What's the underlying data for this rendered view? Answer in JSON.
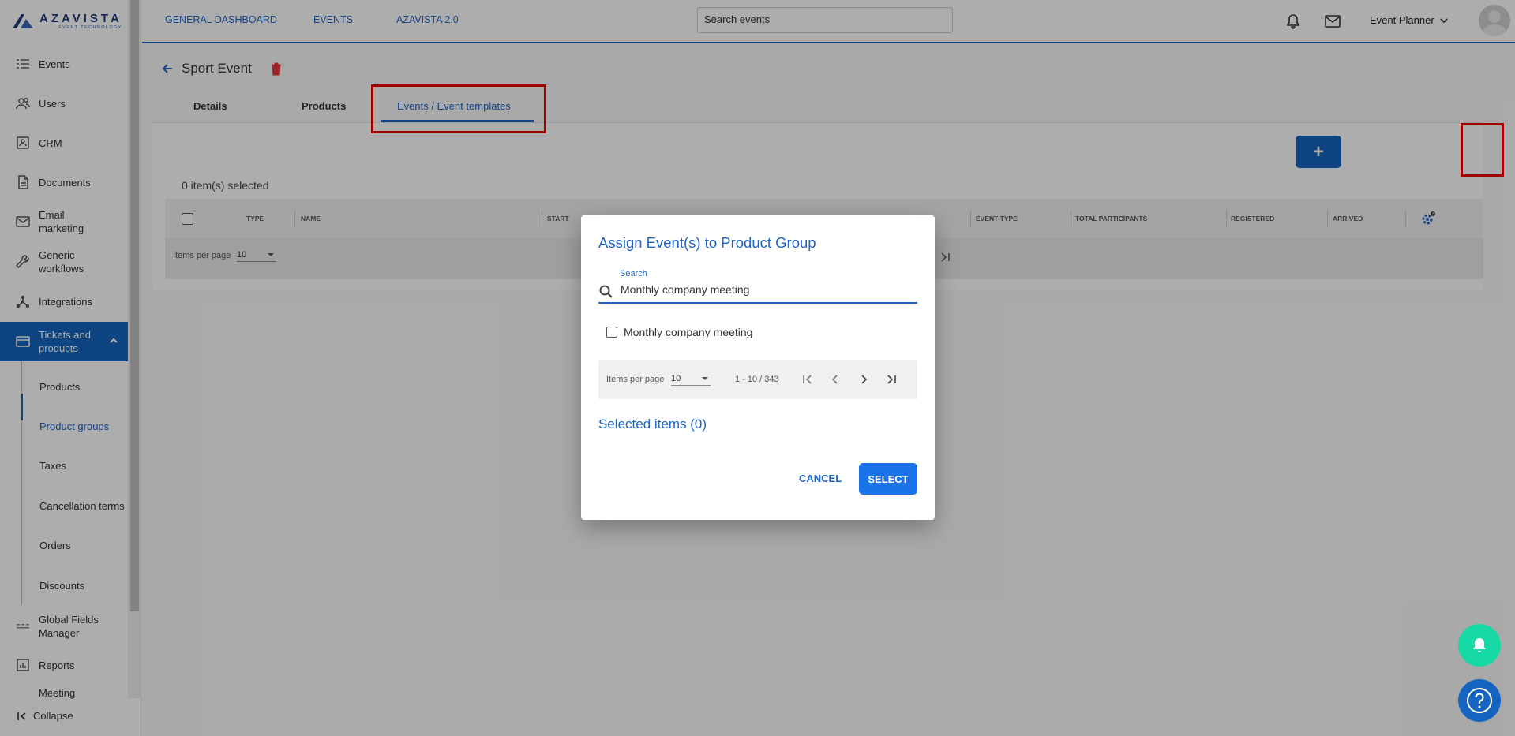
{
  "brand": {
    "name": "AZAVISTA",
    "tagline": "EVENT TECHNOLOGY"
  },
  "topbar": {
    "links": [
      "GENERAL DASHBOARD",
      "EVENTS",
      "AZAVISTA 2.0"
    ],
    "search_value": "Search events",
    "user_role": "Event Planner"
  },
  "sidebar": {
    "items": [
      {
        "label": "Events",
        "icon": "events-icon"
      },
      {
        "label": "Users",
        "icon": "users-icon"
      },
      {
        "label": "CRM",
        "icon": "crm-icon"
      },
      {
        "label": "Documents",
        "icon": "document-icon"
      },
      {
        "label": "Email marketing",
        "icon": "mail-icon"
      },
      {
        "label": "Generic workflows",
        "icon": "wrench-icon"
      },
      {
        "label": "Integrations",
        "icon": "integrations-icon"
      },
      {
        "label": "Tickets and products",
        "icon": "card-icon"
      },
      {
        "label": "Global Fields Manager",
        "icon": "fields-icon"
      },
      {
        "label": "Reports",
        "icon": "reports-icon"
      },
      {
        "label": "Meeting"
      }
    ],
    "subitems": [
      "Products",
      "Product groups",
      "Taxes",
      "Cancellation terms",
      "Orders",
      "Discounts"
    ],
    "collapse_label": "Collapse"
  },
  "page": {
    "title": "Sport Event",
    "tabs": [
      "Details",
      "Products",
      "Events / Event templates"
    ],
    "add_label": "+",
    "selected_count": "0 item(s) selected",
    "columns": [
      "TYPE",
      "NAME",
      "START",
      "EVENT TYPE",
      "TOTAL PARTICIPANTS",
      "REGISTERED",
      "ARRIVED"
    ],
    "items_per_page_label": "Items per page",
    "items_per_page_value": "10"
  },
  "dialog": {
    "title": "Assign Event(s) to Product Group",
    "search_label": "Search",
    "search_value": "Monthly company meeting",
    "result": "Monthly company meeting",
    "items_per_page_label": "Items per page",
    "items_per_page_value": "10",
    "range": "1 - 10 / 343",
    "selected_items": "Selected items (0)",
    "cancel_label": "CANCEL",
    "select_label": "SELECT"
  },
  "colors": {
    "primary": "#1565c0",
    "accent": "#1e63c6",
    "highlight": "#ee0000",
    "bell": "#16d9a5"
  }
}
